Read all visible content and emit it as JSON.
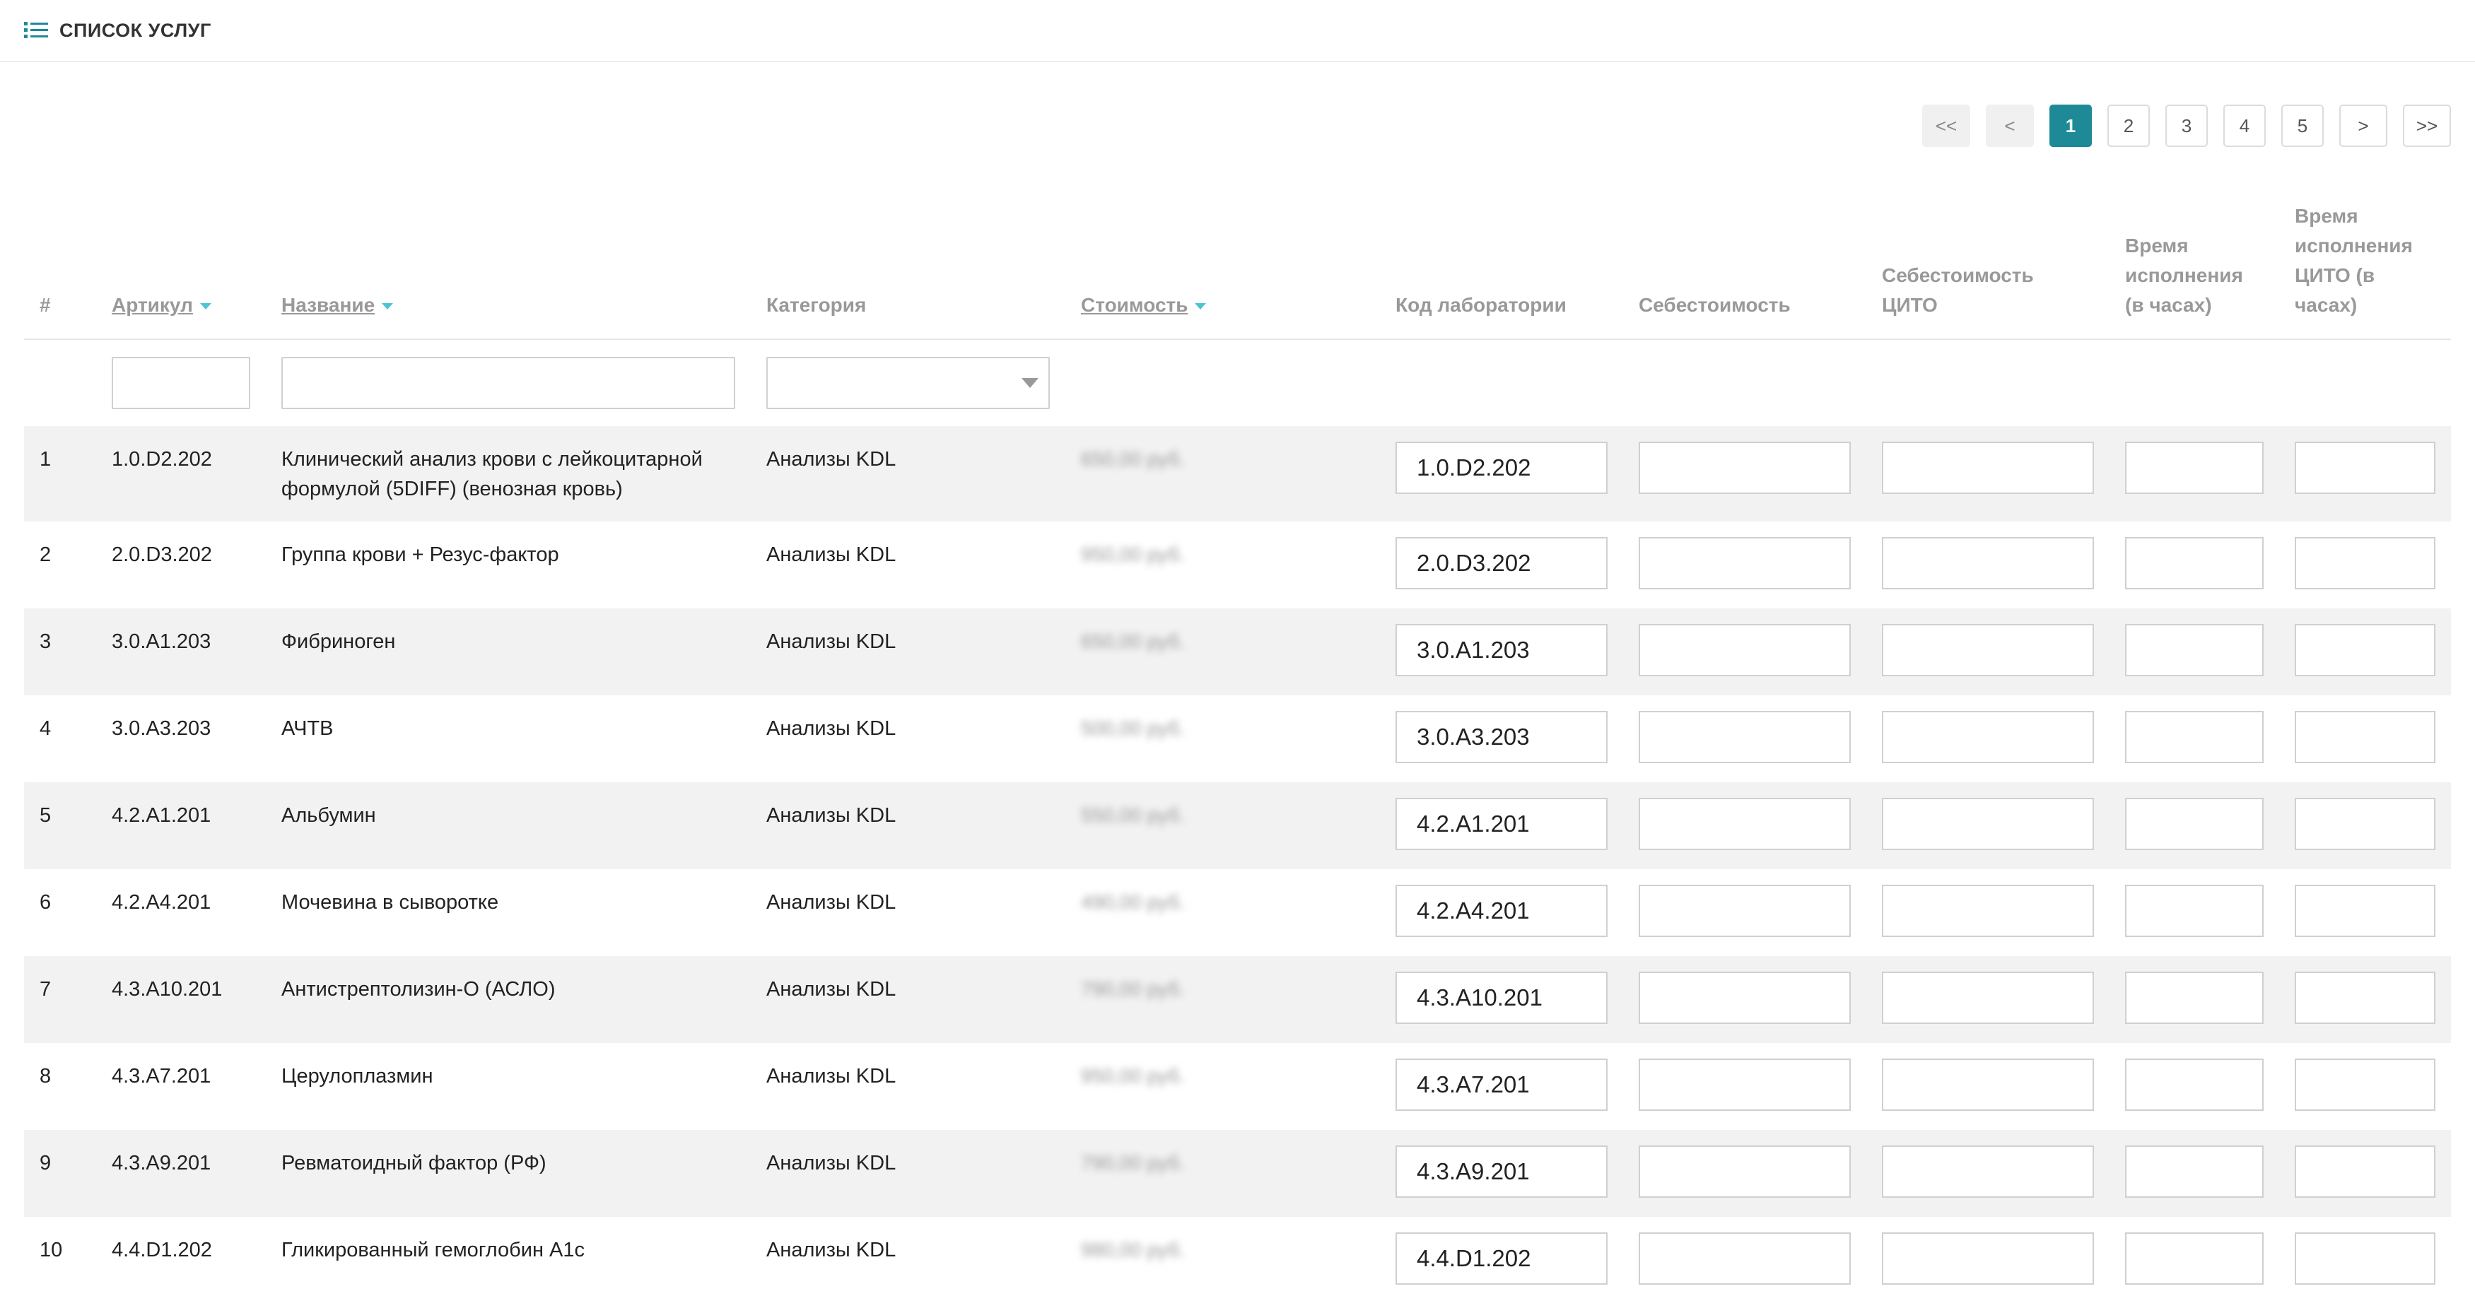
{
  "header": {
    "title": "СПИСОК УСЛУГ",
    "icon": "list-icon"
  },
  "pagination": {
    "first": "<<",
    "prev": "<",
    "pages": [
      "1",
      "2",
      "3",
      "4",
      "5"
    ],
    "active_page": "1",
    "next": ">",
    "last": ">>"
  },
  "columns": {
    "num": "#",
    "article": "Артикул",
    "name": "Название",
    "category": "Категория",
    "cost": "Стоимость",
    "lab_code": "Код лаборатории",
    "self_cost": "Себестоимость",
    "self_cost_cito": "Себестоимость ЦИТО",
    "exec_time": "Время исполнения (в часах)",
    "exec_time_cito": "Время исполнения ЦИТО (в часах)"
  },
  "rows": [
    {
      "num": "1",
      "article": "1.0.D2.202",
      "name": "Клинический анализ крови с лейкоцитарной формулой (5DIFF) (венозная кровь)",
      "category": "Анализы KDL",
      "cost": "650,00 руб.",
      "lab_code": "1.0.D2.202"
    },
    {
      "num": "2",
      "article": "2.0.D3.202",
      "name": "Группа крови + Резус-фактор",
      "category": "Анализы KDL",
      "cost": "950,00 руб.",
      "lab_code": "2.0.D3.202"
    },
    {
      "num": "3",
      "article": "3.0.A1.203",
      "name": "Фибриноген",
      "category": "Анализы KDL",
      "cost": "650,00 руб.",
      "lab_code": "3.0.A1.203"
    },
    {
      "num": "4",
      "article": "3.0.A3.203",
      "name": "АЧТВ",
      "category": "Анализы KDL",
      "cost": "500,00 руб.",
      "lab_code": "3.0.A3.203"
    },
    {
      "num": "5",
      "article": "4.2.A1.201",
      "name": "Альбумин",
      "category": "Анализы KDL",
      "cost": "550,00 руб.",
      "lab_code": "4.2.A1.201"
    },
    {
      "num": "6",
      "article": "4.2.A4.201",
      "name": "Мочевина в сыворотке",
      "category": "Анализы KDL",
      "cost": "490,00 руб.",
      "lab_code": "4.2.A4.201"
    },
    {
      "num": "7",
      "article": "4.3.A10.201",
      "name": "Антистрептолизин-О (АСЛО)",
      "category": "Анализы KDL",
      "cost": "790,00 руб.",
      "lab_code": "4.3.A10.201"
    },
    {
      "num": "8",
      "article": "4.3.A7.201",
      "name": "Церулоплазмин",
      "category": "Анализы KDL",
      "cost": "950,00 руб.",
      "lab_code": "4.3.A7.201"
    },
    {
      "num": "9",
      "article": "4.3.A9.201",
      "name": "Ревматоидный фактор (РФ)",
      "category": "Анализы KDL",
      "cost": "790,00 руб.",
      "lab_code": "4.3.A9.201"
    },
    {
      "num": "10",
      "article": "4.4.D1.202",
      "name": "Гликированный гемоглобин A1c",
      "category": "Анализы KDL",
      "cost": "980,00 руб.",
      "lab_code": "4.4.D1.202"
    }
  ],
  "colors": {
    "accent": "#1e8a98",
    "sort_caret": "#4fc3d3",
    "row_stripe": "#f2f2f2"
  }
}
